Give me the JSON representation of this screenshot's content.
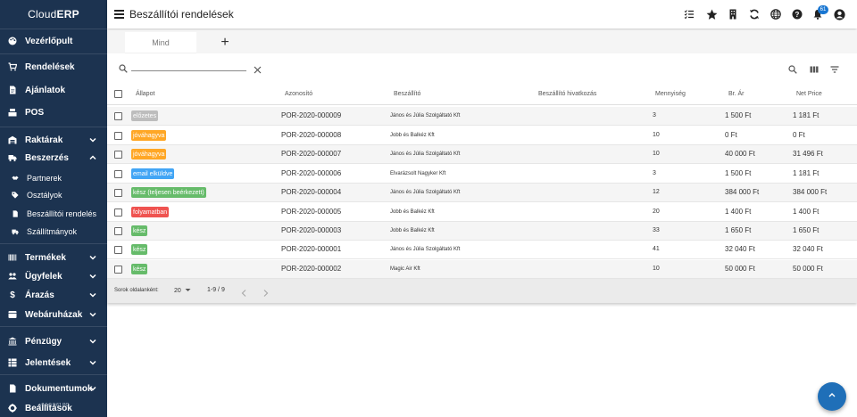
{
  "brand": {
    "name_prefix": "Cloud",
    "name_bold": "ERP"
  },
  "header": {
    "title": "Beszállítói rendelések",
    "notification_count": "61"
  },
  "sidebar": {
    "items": [
      {
        "label": "Vezérlőpult",
        "icon": "palette-icon"
      },
      {
        "label": "Rendelések",
        "icon": "cart-icon"
      },
      {
        "label": "Ajánlatok",
        "icon": "document-icon"
      },
      {
        "label": "POS",
        "icon": "pos-icon"
      },
      {
        "label": "Raktárak",
        "icon": "warehouse-icon"
      },
      {
        "label": "Beszerzés",
        "icon": "truck-icon"
      },
      {
        "label": "Partnerek",
        "icon": "handshake-icon"
      },
      {
        "label": "Osztályok",
        "icon": "tag-icon"
      },
      {
        "label": "Beszállítói rendelés",
        "icon": "document-icon"
      },
      {
        "label": "Szállítmányok",
        "icon": "truck-icon"
      },
      {
        "label": "Termékek",
        "icon": "barcode-icon"
      },
      {
        "label": "Ügyfelek",
        "icon": "users-icon"
      },
      {
        "label": "Árazás",
        "icon": "dollar-icon"
      },
      {
        "label": "Webáruházak",
        "icon": "webshop-icon"
      },
      {
        "label": "Pénzügy",
        "icon": "bank-icon"
      },
      {
        "label": "Jelentések",
        "icon": "report-icon"
      },
      {
        "label": "Dokumentumok",
        "icon": "document-icon"
      },
      {
        "label": "Beállítások",
        "icon": "gear-icon"
      }
    ],
    "version": "v2.1.0 0.61 PC"
  },
  "tabs": {
    "all_label": "Mind",
    "add_label": "+"
  },
  "search": {
    "placeholder": "",
    "value": ""
  },
  "table": {
    "headers": [
      "Állapot",
      "Azonosító",
      "Beszállító",
      "Beszállító hivatkozás",
      "Mennyiség",
      "Br. Ár",
      "Net Price"
    ],
    "rows": [
      {
        "status": "előzetes",
        "status_color": "#bdbdbd",
        "id": "POR-2020-000009",
        "supplier": "János és Júlia Szolgáltató Kft",
        "ref": "",
        "qty": "3",
        "gross": "1 500 Ft",
        "net": "1 181 Ft"
      },
      {
        "status": "jóváhagyva",
        "status_color": "#ffa726",
        "id": "POR-2020-000008",
        "supplier": "Jobb és Balkéz Kft",
        "ref": "",
        "qty": "10",
        "gross": "0 Ft",
        "net": "0 Ft"
      },
      {
        "status": "jóváhagyva",
        "status_color": "#ffa726",
        "id": "POR-2020-000007",
        "supplier": "János és Júlia Szolgáltató Kft",
        "ref": "",
        "qty": "10",
        "gross": "40 000 Ft",
        "net": "31 496 Ft"
      },
      {
        "status": "email elküldve",
        "status_color": "#42a5f5",
        "id": "POR-2020-000006",
        "supplier": "Elvarázsolt Nagyker Kft",
        "ref": "",
        "qty": "3",
        "gross": "1 500 Ft",
        "net": "1 181 Ft"
      },
      {
        "status": "kész (teljesen beérkezett)",
        "status_color": "#66bb6a",
        "id": "POR-2020-000004",
        "supplier": "János és Júlia Szolgáltató Kft",
        "ref": "",
        "qty": "12",
        "gross": "384 000 Ft",
        "net": "384 000 Ft"
      },
      {
        "status": "folyamatban",
        "status_color": "#ef5350",
        "id": "POR-2020-000005",
        "supplier": "Jobb és Balkéz Kft",
        "ref": "",
        "qty": "20",
        "gross": "1 400 Ft",
        "net": "1 400 Ft"
      },
      {
        "status": "kész",
        "status_color": "#66bb6a",
        "id": "POR-2020-000003",
        "supplier": "Jobb és Balkéz Kft",
        "ref": "",
        "qty": "33",
        "gross": "1 650 Ft",
        "net": "1 650 Ft"
      },
      {
        "status": "kész",
        "status_color": "#66bb6a",
        "id": "POR-2020-000001",
        "supplier": "János és Júlia Szolgáltató Kft",
        "ref": "",
        "qty": "41",
        "gross": "32 040 Ft",
        "net": "32 040 Ft"
      },
      {
        "status": "kész",
        "status_color": "#66bb6a",
        "id": "POR-2020-000002",
        "supplier": "Magic Air Kft",
        "ref": "",
        "qty": "10",
        "gross": "50 000 Ft",
        "net": "50 000 Ft"
      }
    ]
  },
  "pagination": {
    "rows_per_page_label": "Sorok oldalanként:",
    "rows_per_page": "20",
    "range": "1-9 / 9"
  },
  "colors": {
    "sidebar_bg": "#1c3350",
    "accent": "#1f6fb8"
  }
}
